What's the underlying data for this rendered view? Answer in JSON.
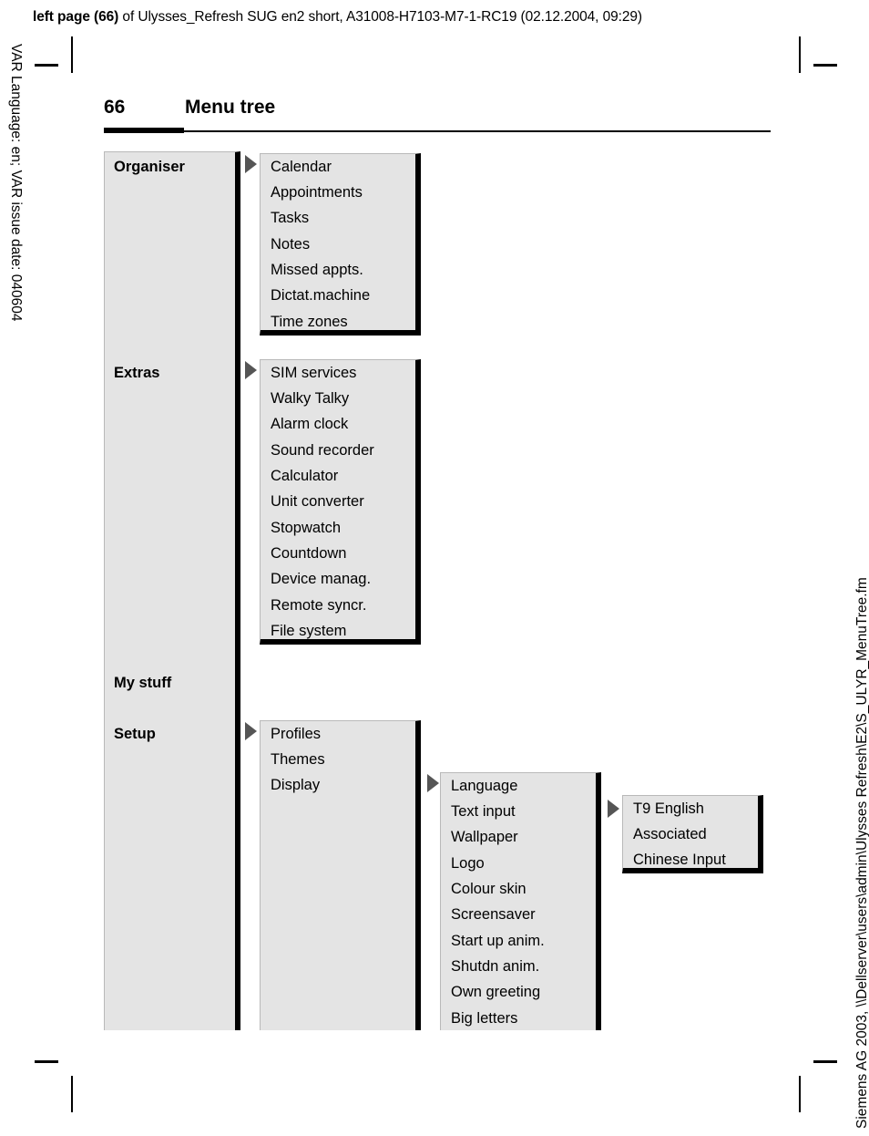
{
  "print_header": {
    "bold_part": "left page (66)",
    "rest": " of Ulysses_Refresh SUG en2 short, A31008-H7103-M7-1-RC19 (02.12.2004, 09:29)"
  },
  "side_text": {
    "left": "VAR Language: en; VAR issue date: 040604",
    "right": "Siemens AG 2003, \\\\Dellserver\\users\\admin\\Ulysses Refresh\\E2\\S_ULYR_MenuTree.fm"
  },
  "page": {
    "number": "66",
    "title": "Menu tree"
  },
  "menu": {
    "level1": [
      {
        "label": "Organiser"
      },
      {
        "label": "Extras"
      },
      {
        "label": "My stuff"
      },
      {
        "label": "Setup"
      }
    ],
    "organiser_items": [
      "Calendar",
      "Appointments",
      "Tasks",
      "Notes",
      "Missed appts.",
      "Dictat.machine",
      "Time zones"
    ],
    "extras_items": [
      "SIM services",
      "Walky Talky",
      "Alarm clock",
      "Sound recorder",
      "Calculator",
      "Unit converter",
      "Stopwatch",
      "Countdown",
      "Device manag.",
      "Remote syncr.",
      "File system"
    ],
    "setup_items": [
      "Profiles",
      "Themes",
      "Display"
    ],
    "display_items": [
      "Language",
      "Text input",
      "Wallpaper",
      "Logo",
      "Colour skin",
      "Screensaver",
      "Start up anim.",
      "Shutdn anim.",
      "Own greeting",
      "Big letters"
    ],
    "text_input_items": [
      "T9 English",
      "Associated",
      "Chinese Input"
    ]
  },
  "colors": {
    "box_fill": "#e4e4e4",
    "box_border": "#000000",
    "arrow": "#555555"
  }
}
